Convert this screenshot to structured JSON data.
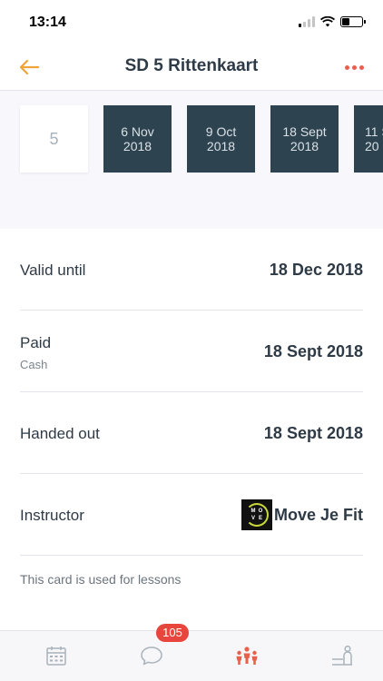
{
  "status_bar": {
    "time": "13:14"
  },
  "nav": {
    "title": "SD 5 Rittenkaart"
  },
  "rides": {
    "remaining": "5",
    "dates": [
      {
        "day": "6 Nov",
        "year": "2018"
      },
      {
        "day": "9 Oct",
        "year": "2018"
      },
      {
        "day": "18 Sept",
        "year": "2018"
      },
      {
        "day": "11 S",
        "year": "20"
      }
    ]
  },
  "details": {
    "valid_until": {
      "label": "Valid until",
      "value": "18 Dec 2018"
    },
    "paid": {
      "label": "Paid",
      "method": "Cash",
      "value": "18 Sept 2018"
    },
    "handed_out": {
      "label": "Handed out",
      "value": "18 Sept 2018"
    },
    "instructor": {
      "label": "Instructor",
      "name": "Move Je Fit",
      "logo_letters": [
        "M",
        "O",
        "V",
        "E"
      ]
    }
  },
  "usage_note": "This card is used for lessons",
  "tab_bar": {
    "messages_badge": "105",
    "active_color": "#e8604c",
    "inactive_color": "#a9b2ba"
  },
  "colors": {
    "accent_orange": "#f0a33a",
    "accent_red": "#e8604c",
    "ride_box": "#2e4350"
  }
}
